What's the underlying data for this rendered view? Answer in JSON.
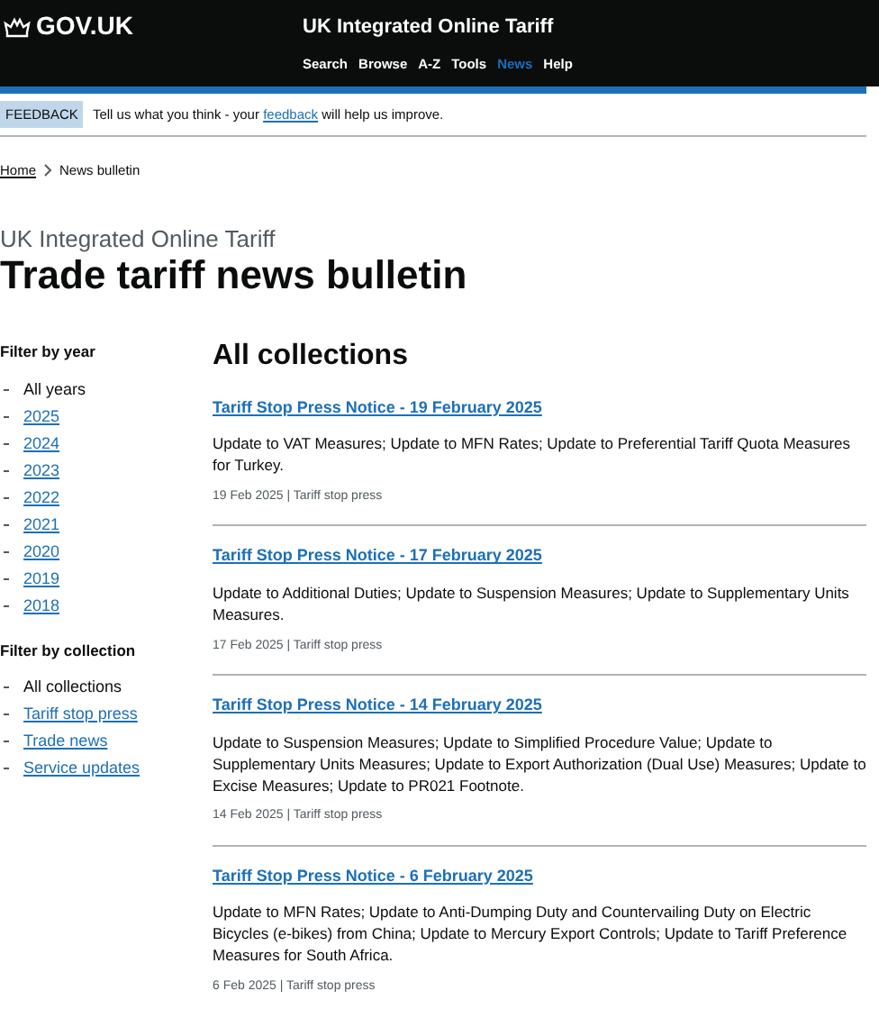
{
  "header": {
    "logo": "GOV.UK",
    "service": "UK Integrated Online Tariff",
    "nav": [
      {
        "label": "Search",
        "selected": false
      },
      {
        "label": "Browse",
        "selected": false
      },
      {
        "label": "A-Z",
        "selected": false
      },
      {
        "label": "Tools",
        "selected": false
      },
      {
        "label": "News",
        "selected": true
      },
      {
        "label": "Help",
        "selected": false
      }
    ]
  },
  "feedback": {
    "tag": "FEEDBACK",
    "text_before": "Tell us what you think - your ",
    "link": "feedback",
    "text_after": " will help us improve."
  },
  "breadcrumb": [
    {
      "label": "Home"
    },
    {
      "label": "News bulletin"
    }
  ],
  "caption": "UK Integrated Online Tariff",
  "title": "Trade tariff news bulletin",
  "filters": [
    {
      "heading": "Filter by year",
      "items": [
        {
          "label": "All years",
          "selected": true
        },
        {
          "label": "2025",
          "selected": false
        },
        {
          "label": "2024",
          "selected": false
        },
        {
          "label": "2023",
          "selected": false
        },
        {
          "label": "2022",
          "selected": false
        },
        {
          "label": "2021",
          "selected": false
        },
        {
          "label": "2020",
          "selected": false
        },
        {
          "label": "2019",
          "selected": false
        },
        {
          "label": "2018",
          "selected": false
        }
      ]
    },
    {
      "heading": "Filter by collection",
      "items": [
        {
          "label": "All collections",
          "selected": true
        },
        {
          "label": "Tariff stop press",
          "selected": false
        },
        {
          "label": "Trade news",
          "selected": false
        },
        {
          "label": "Service updates",
          "selected": false
        }
      ]
    }
  ],
  "list_heading": "All collections",
  "articles": [
    {
      "title": "Tariff Stop Press Notice - 19 February 2025",
      "summary": "Update to VAT Measures; Update to MFN Rates; Update to Preferential Tariff Quota Measures for Turkey.",
      "meta": "19 Feb 2025 | Tariff stop press"
    },
    {
      "title": "Tariff Stop Press Notice - 17 February 2025",
      "summary": "Update to Additional Duties; Update to Suspension Measures; Update to Supplementary Units Measures.",
      "meta": "17 Feb 2025 | Tariff stop press"
    },
    {
      "title": "Tariff Stop Press Notice - 14 February 2025",
      "summary": "Update to Suspension Measures; Update to Simplified Procedure Value; Update to Supplementary Units Measures; Update to Export Authorization (Dual Use) Measures; Update to Excise Measures; Update to PR021 Footnote.",
      "meta": "14 Feb 2025 | Tariff stop press"
    },
    {
      "title": "Tariff Stop Press Notice - 6 February 2025",
      "summary": "Update to MFN Rates; Update to Anti-Dumping Duty and Countervailing Duty on Electric Bicycles (e-bikes) from China; Update to Mercury Export Controls; Update to Tariff Preference Measures for South Africa.",
      "meta": "6 Feb 2025 | Tariff stop press"
    }
  ]
}
